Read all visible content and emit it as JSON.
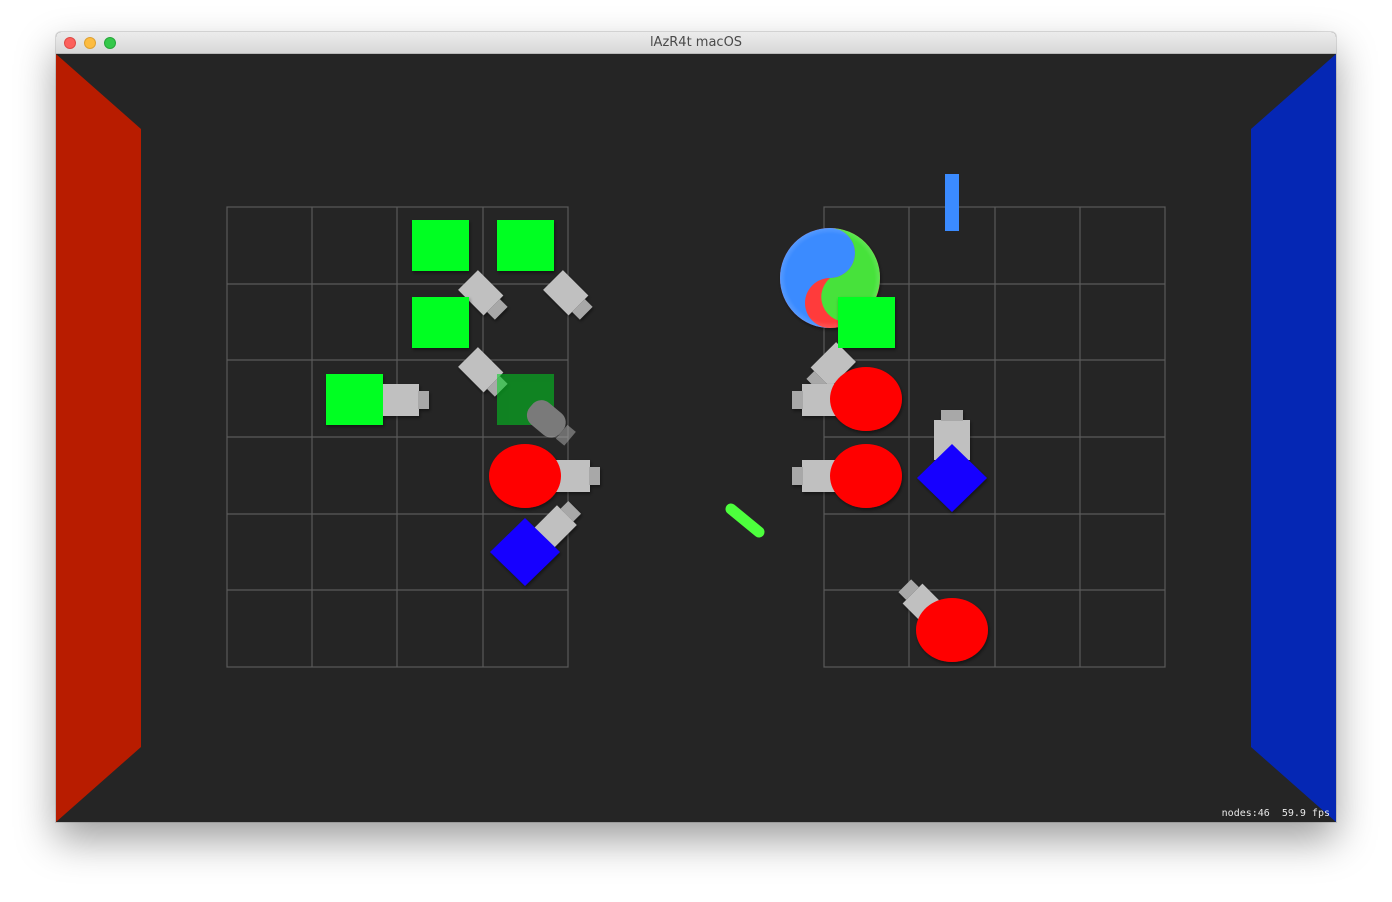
{
  "window": {
    "title": "lAzR4t macOS",
    "buttons": [
      "close",
      "minimize",
      "zoom"
    ]
  },
  "colors": {
    "background": "#252525",
    "grid_line": "#5a5a5a",
    "left_wall": "#b81c00",
    "right_wall": "#0527b4",
    "green_unit": "#00ff22",
    "red_unit": "#ff0000",
    "blue_unit": "#1200ff",
    "turret": "#c0c0c0",
    "projectile_blue": "#3b8bff",
    "projectile_green": "#4dff3d"
  },
  "game": {
    "grids": [
      {
        "name": "left-grid",
        "cols": 4,
        "rows": 6
      },
      {
        "name": "right-grid",
        "cols": 4,
        "rows": 6
      }
    ],
    "units": [
      {
        "name": "green-square-unit",
        "shape": "square",
        "color": "green"
      },
      {
        "name": "green-square-unit",
        "shape": "square",
        "color": "green"
      },
      {
        "name": "green-square-unit",
        "shape": "square",
        "color": "green"
      },
      {
        "name": "green-square-unit",
        "shape": "square",
        "color": "green"
      },
      {
        "name": "green-square-unit-ghost",
        "shape": "square",
        "color": "green",
        "ghost": true
      },
      {
        "name": "red-circle-unit",
        "shape": "circle",
        "color": "red"
      },
      {
        "name": "blue-diamond-unit",
        "shape": "diamond",
        "color": "blue"
      },
      {
        "name": "green-square-unit",
        "shape": "square",
        "color": "green"
      },
      {
        "name": "red-circle-unit",
        "shape": "circle",
        "color": "red"
      },
      {
        "name": "red-circle-unit",
        "shape": "circle",
        "color": "red"
      },
      {
        "name": "blue-diamond-unit",
        "shape": "diamond",
        "color": "blue"
      },
      {
        "name": "red-circle-unit",
        "shape": "circle",
        "color": "red"
      }
    ],
    "projectiles": [
      {
        "name": "blue-laser-projectile",
        "color": "blue"
      },
      {
        "name": "green-laser-projectile",
        "color": "green"
      }
    ],
    "spawner": {
      "name": "tricolor-spawner-orb",
      "colors": [
        "blue",
        "green",
        "red"
      ]
    }
  },
  "stats": {
    "nodes": "nodes:46",
    "fps": "59.9 fps"
  }
}
